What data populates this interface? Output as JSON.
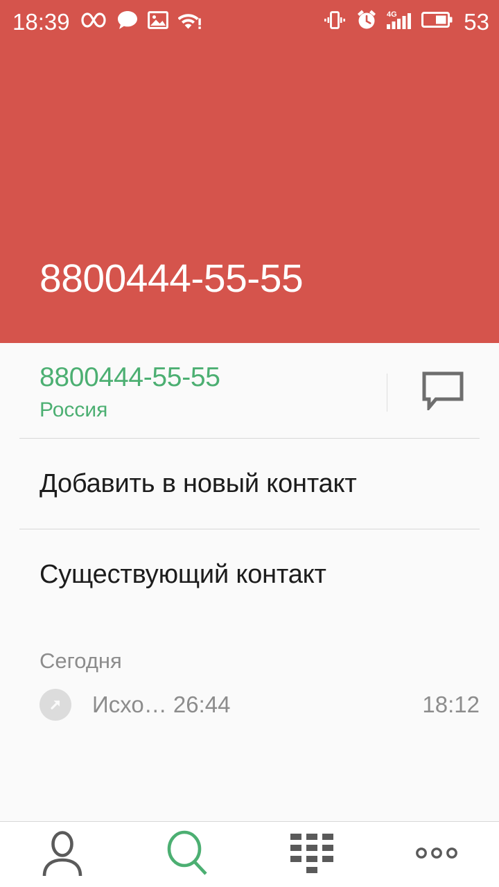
{
  "status_bar": {
    "clock": "18:39",
    "battery_percent": "53",
    "left_icons": [
      "infinity-icon",
      "message-bubble-icon",
      "photo-icon",
      "wifi-alert-icon"
    ],
    "right_icons": [
      "vibrate-icon",
      "alarm-clock-icon",
      "signal-4g-icon",
      "battery-icon"
    ],
    "network_label": "4G",
    "background_color": "#d5544c"
  },
  "header": {
    "phone_number": "8800444-55-55",
    "background_color": "#d5544c",
    "text_color": "#ffffff"
  },
  "number_card": {
    "phone_number": "8800444-55-55",
    "country": "Россия",
    "accent_color": "#4caf72",
    "sms_icon": "message-bubble-icon"
  },
  "actions": [
    {
      "label": "Добавить в новый контакт"
    },
    {
      "label": "Существующий контакт"
    }
  ],
  "call_history": {
    "section_title": "Сегодня",
    "entries": [
      {
        "icon": "outgoing-call-arrow-icon",
        "type_and_duration": "Исхо… 26:44",
        "time": "18:12"
      }
    ]
  },
  "bottom_nav": {
    "items": [
      {
        "name": "contacts",
        "icon": "person-icon",
        "active": false
      },
      {
        "name": "search",
        "icon": "search-icon",
        "active": true
      },
      {
        "name": "dialpad",
        "icon": "dialpad-icon",
        "active": false
      },
      {
        "name": "more",
        "icon": "more-dots-icon",
        "active": false
      }
    ],
    "active_color": "#4caf72",
    "inactive_color": "#5a5a5a"
  }
}
